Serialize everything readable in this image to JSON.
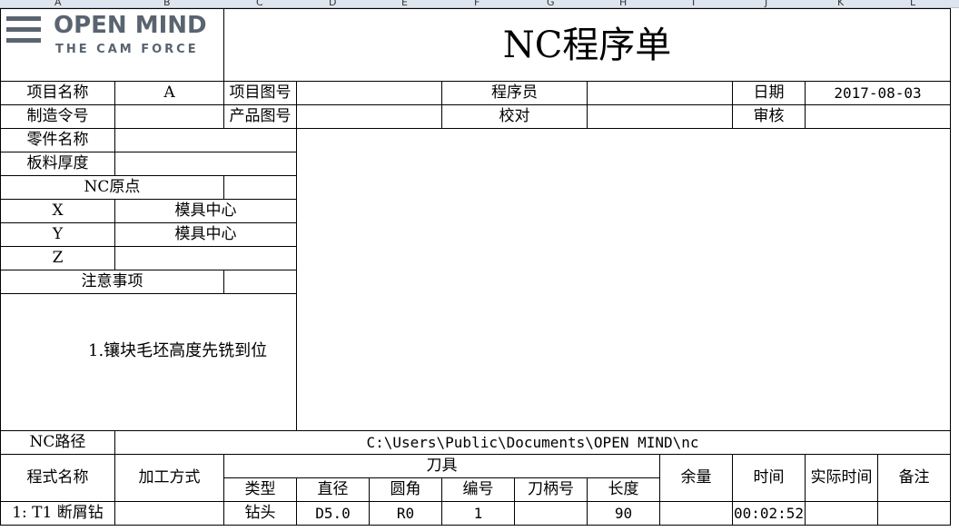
{
  "column_headers": [
    "A",
    "B",
    "C",
    "D",
    "E",
    "F",
    "G",
    "H",
    "I",
    "J",
    "K",
    "L"
  ],
  "logo": {
    "brand_top": "OPEN MIND",
    "brand_bottom": "THE CAM FORCE",
    "color": "#5a6470"
  },
  "title": "NC程序单",
  "header": {
    "project_name_label": "项目名称",
    "project_name_value": "A",
    "project_drawing_label": "项目图号",
    "project_drawing_value": "",
    "programmer_label": "程序员",
    "programmer_value": "",
    "date_label": "日期",
    "date_value": "2017-08-03",
    "order_label": "制造令号",
    "order_value": "",
    "product_drawing_label": "产品图号",
    "product_drawing_value": "",
    "check_label": "校对",
    "check_value": "",
    "review_label": "审核",
    "review_value": ""
  },
  "part": {
    "part_name_label": "零件名称",
    "part_name_value": "",
    "thickness_label": "板料厚度",
    "thickness_value": "",
    "origin_label": "NC原点",
    "origin_value": "",
    "x_label": "X",
    "x_value": "模具中心",
    "y_label": "Y",
    "y_value": "模具中心",
    "z_label": "Z",
    "z_value": "",
    "notes_label": "注意事项",
    "notes_value": "",
    "note_text": "1.镶块毛坯高度先铣到位"
  },
  "path": {
    "label": "NC路径",
    "value": "C:\\Users\\Public\\Documents\\OPEN MIND\\nc"
  },
  "table_header": {
    "program_name": "程式名称",
    "machining_method": "加工方式",
    "tool": "刀具",
    "type": "类型",
    "diameter": "直径",
    "corner": "圆角",
    "number": "编号",
    "holder": "刀柄号",
    "length": "长度",
    "stock": "余量",
    "time": "时间",
    "actual_time": "实际时间",
    "remarks": "备注"
  },
  "rows": [
    {
      "program_name": "1: T1 断屑钻",
      "machining_method": "",
      "type": "钻头",
      "diameter": "D5.0",
      "corner": "R0",
      "number": "1",
      "holder": "",
      "length": "90",
      "stock": "",
      "time": "00:02:52",
      "actual_time": "",
      "remarks": ""
    }
  ]
}
